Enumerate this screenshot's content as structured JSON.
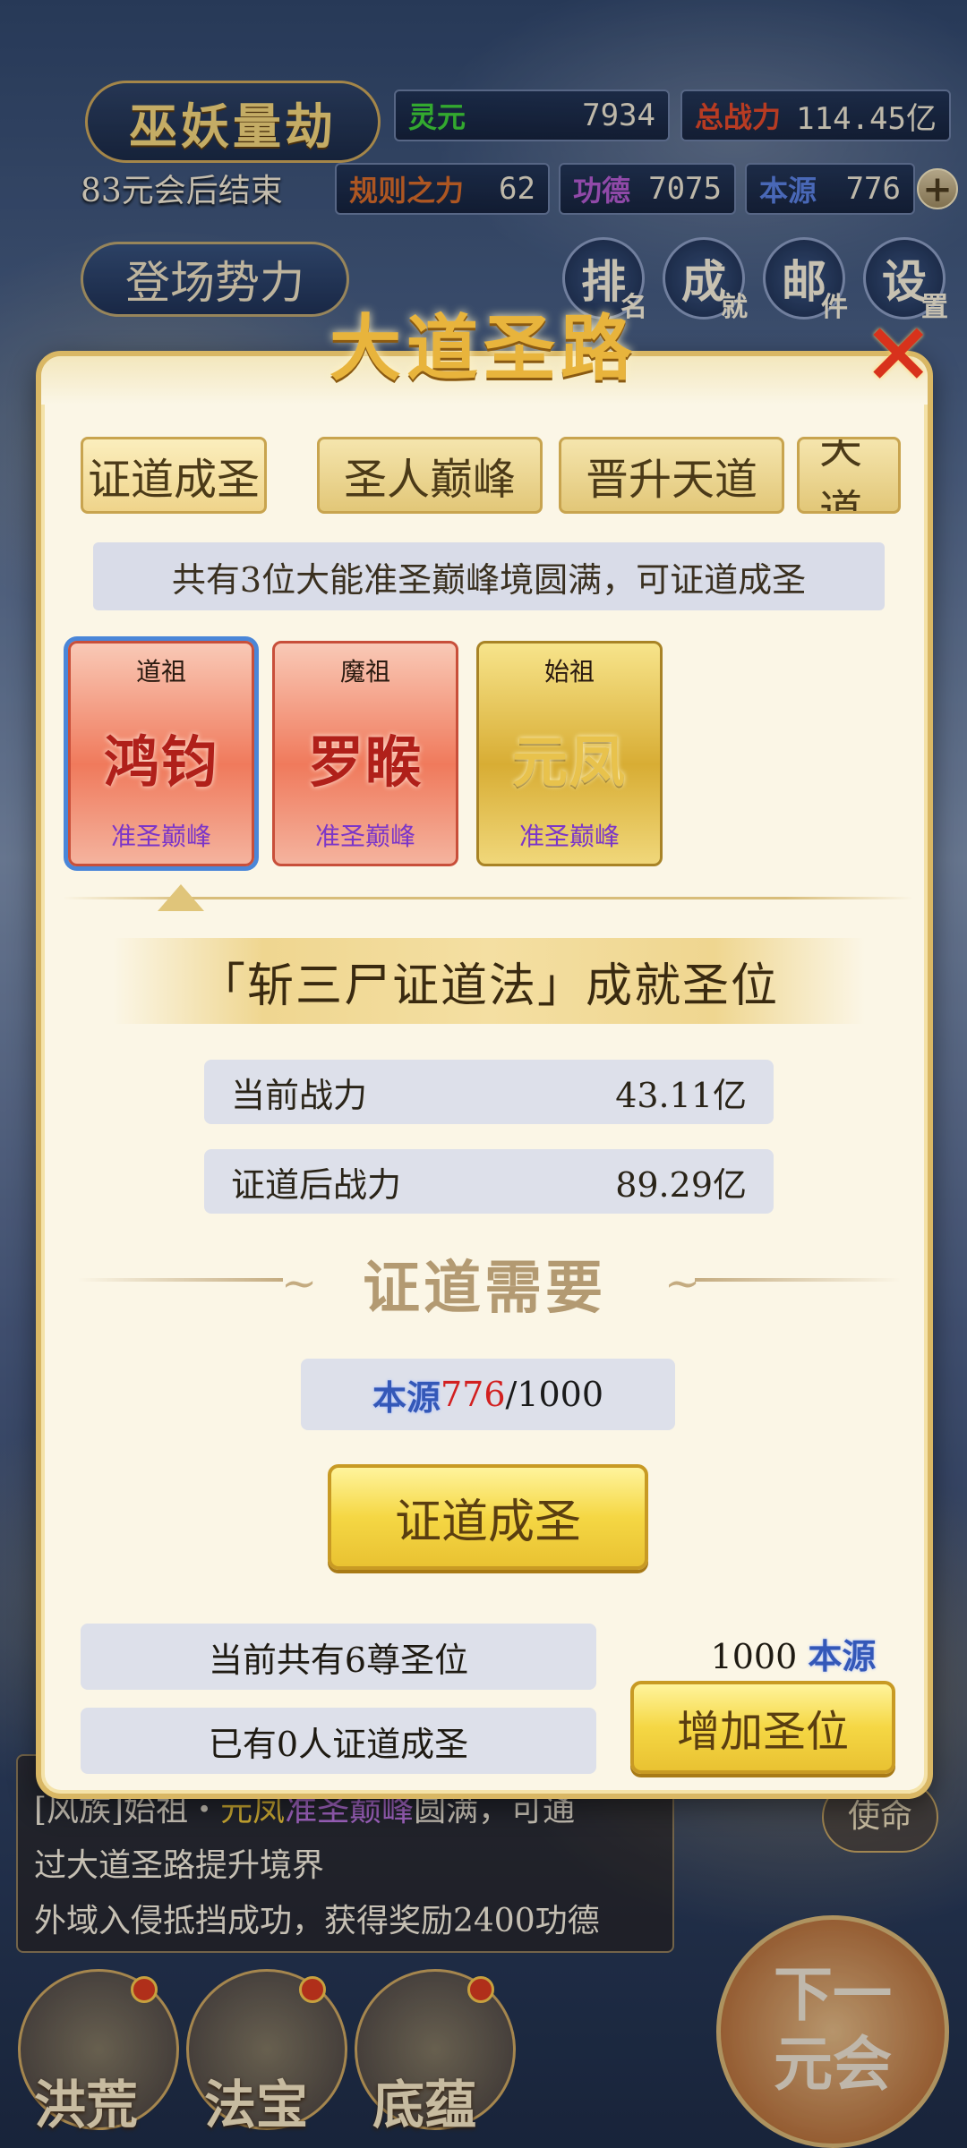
{
  "hud": {
    "title": "巫妖量劫",
    "lingyuan_label": "灵元",
    "lingyuan_value": "7934",
    "total_power_label": "总战力",
    "total_power_value": "114.45亿",
    "end_text": "83元会后结束",
    "rule_label": "规则之力",
    "rule_value": "62",
    "merit_label": "功德",
    "merit_value": "7075",
    "source_label": "本源",
    "source_value": "776",
    "faction_button": "登场势力",
    "icons": [
      {
        "main": "排",
        "sub": "名"
      },
      {
        "main": "成",
        "sub": "就"
      },
      {
        "main": "邮",
        "sub": "件"
      },
      {
        "main": "设",
        "sub": "置"
      }
    ],
    "colors": {
      "lingyuan": "#3fcf3a",
      "total_power": "#e0482a",
      "rule": "#d46a2a",
      "merit": "#b05acd",
      "source": "#5a7fe0"
    }
  },
  "modal": {
    "title": "大道圣路",
    "close_icon": "close-icon",
    "tabs": [
      "证道成圣",
      "圣人巅峰",
      "晋升天道",
      "天道"
    ],
    "info": "共有3位大能准圣巅峰境圆满，可证道成圣",
    "cards": [
      {
        "top": "道祖",
        "name": "鸿钧",
        "rank": "准圣巅峰",
        "style": "red"
      },
      {
        "top": "魔祖",
        "name": "罗睺",
        "rank": "准圣巅峰",
        "style": "red"
      },
      {
        "top": "始祖",
        "name": "元凤",
        "rank": "准圣巅峰",
        "style": "gold"
      }
    ],
    "method": "「斩三尸证道法」成就圣位",
    "current_power_label": "当前战力",
    "current_power_value": "43.11亿",
    "after_power_label": "证道后战力",
    "after_power_value": "89.29亿",
    "requirement_title": "证道需要",
    "req_label": "本源",
    "req_current": "776",
    "req_total": "/1000",
    "main_button": "证道成圣",
    "seat_count": "当前共有6尊圣位",
    "saint_count": "已有0人证道成圣",
    "cost_value": "1000",
    "cost_label": "本源",
    "add_button": "增加圣位"
  },
  "background": {
    "log_line1_a": "[风族]始祖・",
    "log_line1_b": "元凤",
    "log_line1_c": "准圣巅峰",
    "log_line1_d": "圆满，可通",
    "log_line2": "过大道圣路提升境界",
    "log_line3": "外域入侵抵挡成功，获得奖励2400功德",
    "mission": "使命",
    "nav": [
      "洪荒",
      "法宝",
      "底蕴"
    ],
    "next_button_1": "下一",
    "next_button_2": "元会"
  }
}
